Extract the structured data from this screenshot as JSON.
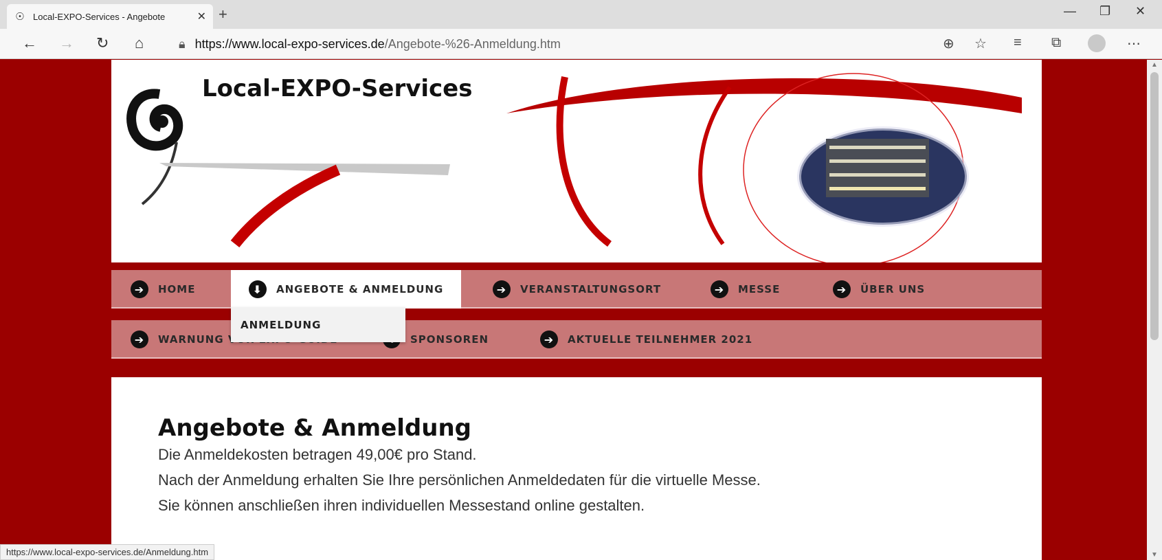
{
  "browser": {
    "tab_title": "Local-EXPO-Services - Angebote",
    "tab_favicon": "site-logo-icon",
    "url_host": "https://www.local-expo-services.de",
    "url_path": "/Angebote-%26-Anmeldung.htm",
    "status_url": "https://www.local-expo-services.de/Anmeldung.htm"
  },
  "site": {
    "logo_text": "Local-EXPO-Services",
    "brand_color": "#9b0000"
  },
  "nav": {
    "row1": [
      {
        "label": "HOME"
      },
      {
        "label": "ANGEBOTE & ANMELDUNG",
        "active": true
      },
      {
        "label": "VERANSTALTUNGSORT"
      },
      {
        "label": "MESSE"
      },
      {
        "label": "ÜBER UNS"
      }
    ],
    "row2": [
      {
        "label": "WARNUNG VOR EXPO-GUIDE"
      },
      {
        "label": "SPONSOREN"
      },
      {
        "label": "AKTUELLE TEILNEHMER 2021"
      }
    ],
    "dropdown_item": "ANMELDUNG"
  },
  "content": {
    "heading": "Angebote & Anmeldung",
    "paragraphs": [
      "Die Anmeldekosten betragen 49,00€ pro Stand.",
      "Nach der Anmeldung erhalten Sie Ihre persönlichen Anmeldedaten für die virtuelle Messe.",
      "Sie können anschließen ihren individuellen Messestand online gestalten."
    ]
  }
}
